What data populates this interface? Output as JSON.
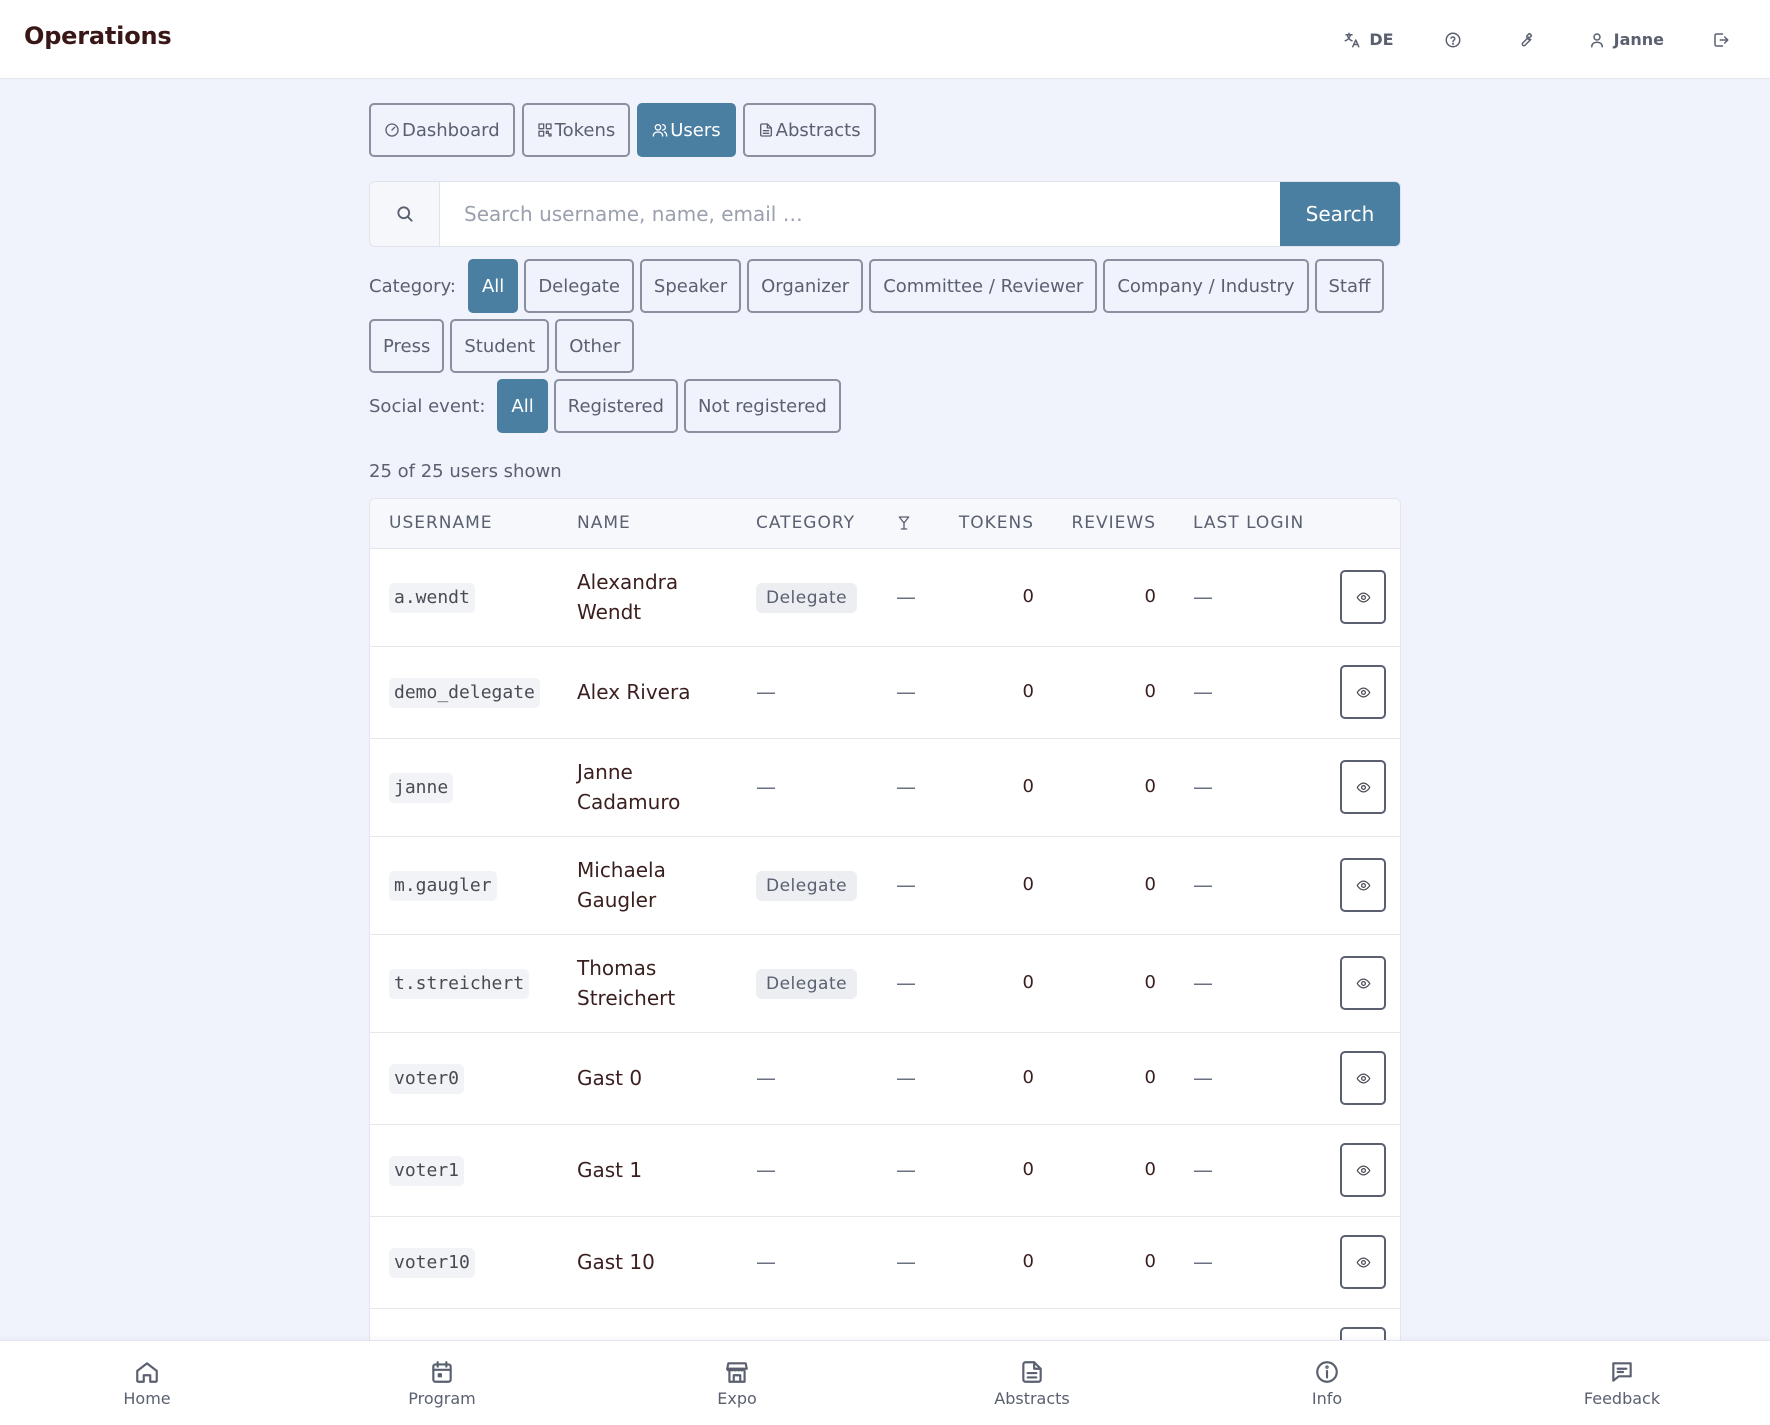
{
  "header": {
    "title": "Operations",
    "language": "DE",
    "user": "Janne"
  },
  "navtabs": [
    {
      "label": "Dashboard",
      "icon": "gauge-icon",
      "active": false
    },
    {
      "label": "Tokens",
      "icon": "qr-code-icon",
      "active": false
    },
    {
      "label": "Users",
      "icon": "users-icon",
      "active": true
    },
    {
      "label": "Abstracts",
      "icon": "file-icon",
      "active": false
    }
  ],
  "search": {
    "placeholder": "Search username, name, email …",
    "value": "",
    "button_label": "Search"
  },
  "filters": {
    "category_label": "Category:",
    "categories": [
      "All",
      "Delegate",
      "Speaker",
      "Organizer",
      "Committee / Reviewer",
      "Company / Industry",
      "Staff",
      "Press",
      "Student",
      "Other"
    ],
    "category_selected": "All",
    "social_label": "Social event:",
    "social_options": [
      "All",
      "Registered",
      "Not registered"
    ],
    "social_selected": "All"
  },
  "count_text": "25 of 25 users shown",
  "table": {
    "headers": {
      "username": "USERNAME",
      "name": "NAME",
      "category": "CATEGORY",
      "social_icon": "cocktail-glass-icon",
      "tokens": "TOKENS",
      "reviews": "REVIEWS",
      "last_login": "LAST LOGIN"
    },
    "rows": [
      {
        "username": "a.wendt",
        "name": "Alexandra Wendt",
        "category": "Delegate",
        "social": "—",
        "tokens": "0",
        "reviews": "0",
        "last_login": "—"
      },
      {
        "username": "demo_delegate",
        "name": "Alex Rivera",
        "category": "—",
        "social": "—",
        "tokens": "0",
        "reviews": "0",
        "last_login": "—"
      },
      {
        "username": "janne",
        "name": "Janne Cadamuro",
        "category": "—",
        "social": "—",
        "tokens": "0",
        "reviews": "0",
        "last_login": "—"
      },
      {
        "username": "m.gaugler",
        "name": "Michaela Gaugler",
        "category": "Delegate",
        "social": "—",
        "tokens": "0",
        "reviews": "0",
        "last_login": "—"
      },
      {
        "username": "t.streichert",
        "name": "Thomas Streichert",
        "category": "Delegate",
        "social": "—",
        "tokens": "0",
        "reviews": "0",
        "last_login": "—"
      },
      {
        "username": "voter0",
        "name": "Gast 0",
        "category": "—",
        "social": "—",
        "tokens": "0",
        "reviews": "0",
        "last_login": "—"
      },
      {
        "username": "voter1",
        "name": "Gast 1",
        "category": "—",
        "social": "—",
        "tokens": "0",
        "reviews": "0",
        "last_login": "—"
      },
      {
        "username": "voter10",
        "name": "Gast 10",
        "category": "—",
        "social": "—",
        "tokens": "0",
        "reviews": "0",
        "last_login": "—"
      }
    ]
  },
  "bottomnav": [
    {
      "label": "Home",
      "icon": "home-icon"
    },
    {
      "label": "Program",
      "icon": "calendar-icon"
    },
    {
      "label": "Expo",
      "icon": "store-icon"
    },
    {
      "label": "Abstracts",
      "icon": "document-icon"
    },
    {
      "label": "Info",
      "icon": "info-icon"
    },
    {
      "label": "Feedback",
      "icon": "message-icon"
    }
  ],
  "colors": {
    "accent": "#4a7fa1",
    "background": "#f0f3fc",
    "title_text": "#3a1717"
  }
}
